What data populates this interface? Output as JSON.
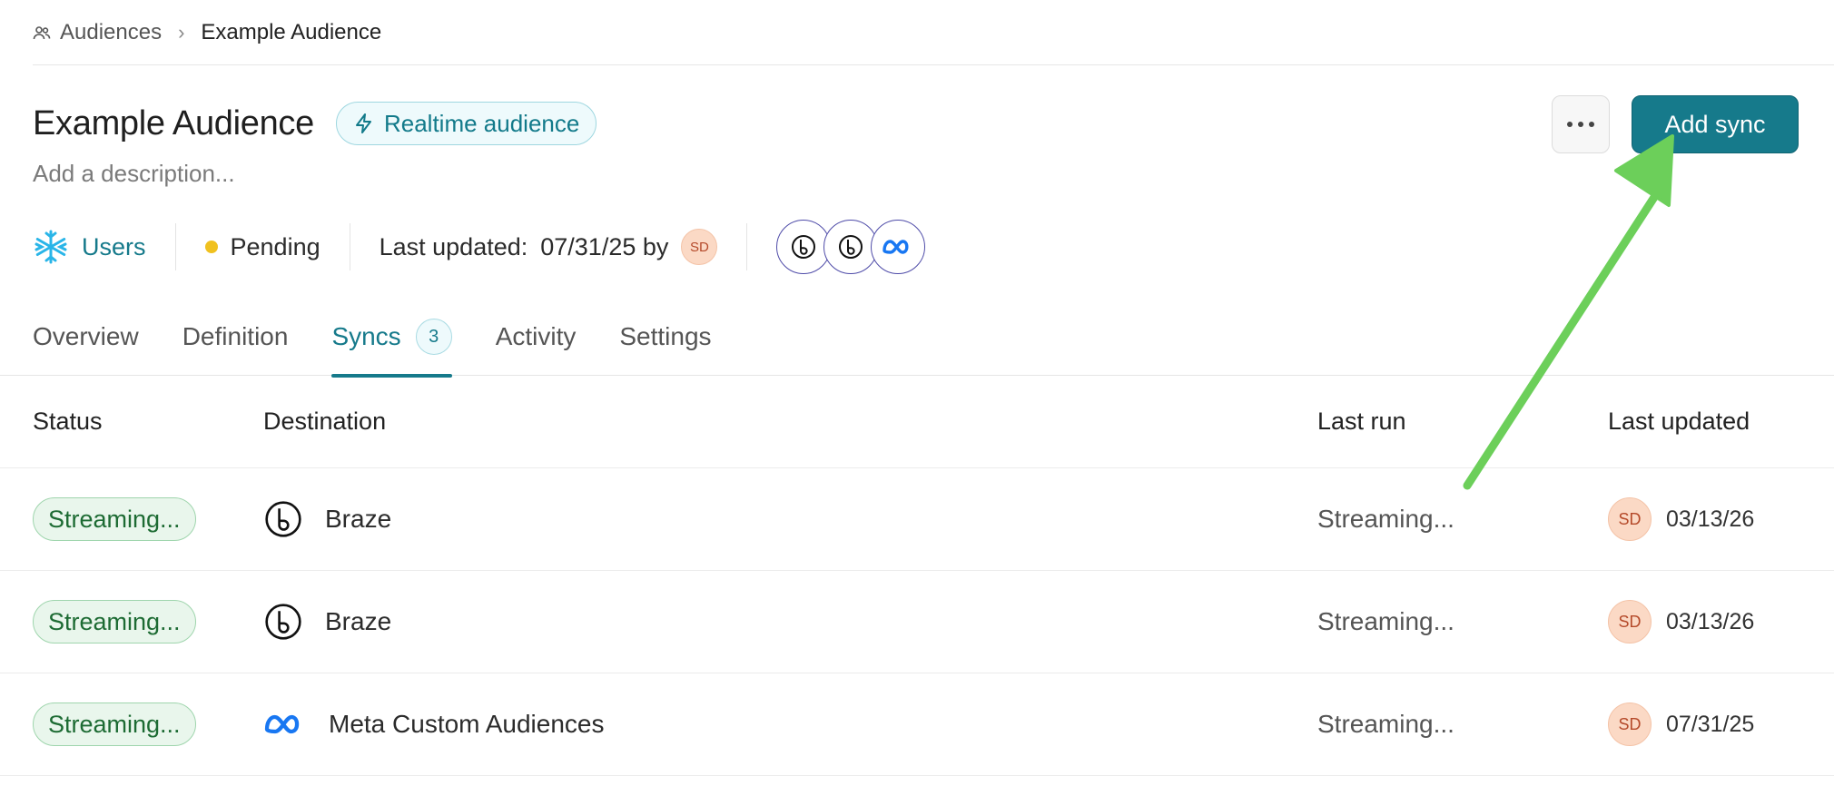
{
  "breadcrumb": {
    "root": "Audiences",
    "current": "Example Audience"
  },
  "header": {
    "title": "Example Audience",
    "badge": "Realtime audience",
    "description_placeholder": "Add a description...",
    "add_sync_label": "Add sync"
  },
  "meta": {
    "source": "Users",
    "status": "Pending",
    "last_updated_label": "Last updated:",
    "last_updated_value": "07/31/25 by",
    "user_initials": "SD"
  },
  "tabs": [
    {
      "label": "Overview"
    },
    {
      "label": "Definition"
    },
    {
      "label": "Syncs",
      "count": "3"
    },
    {
      "label": "Activity"
    },
    {
      "label": "Settings"
    }
  ],
  "table": {
    "headers": {
      "status": "Status",
      "destination": "Destination",
      "last_run": "Last run",
      "last_updated": "Last updated"
    },
    "rows": [
      {
        "status": "Streaming...",
        "destination": "Braze",
        "icon": "braze-icon",
        "last_run": "Streaming...",
        "initials": "SD",
        "updated": "03/13/26"
      },
      {
        "status": "Streaming...",
        "destination": "Braze",
        "icon": "braze-icon",
        "last_run": "Streaming...",
        "initials": "SD",
        "updated": "03/13/26"
      },
      {
        "status": "Streaming...",
        "destination": "Meta Custom Audiences",
        "icon": "meta-icon",
        "last_run": "Streaming...",
        "initials": "SD",
        "updated": "07/31/25"
      }
    ]
  },
  "colors": {
    "accent": "#167a8b",
    "pending": "#f0c11f",
    "streaming_bg": "#e9f6ec",
    "annotation_arrow": "#6ccf5a"
  }
}
